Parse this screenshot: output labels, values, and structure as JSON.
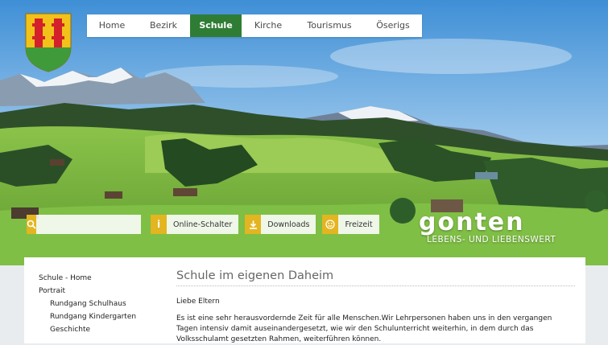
{
  "nav": {
    "items": [
      {
        "label": "Home",
        "active": false
      },
      {
        "label": "Bezirk",
        "active": false
      },
      {
        "label": "Schule",
        "active": true
      },
      {
        "label": "Kirche",
        "active": false
      },
      {
        "label": "Tourismus",
        "active": false
      },
      {
        "label": "Öserigs",
        "active": false
      }
    ]
  },
  "toolbar": {
    "search_placeholder": "",
    "buttons": [
      {
        "label": "Online-Schalter",
        "icon": "info-icon"
      },
      {
        "label": "Downloads",
        "icon": "download-icon"
      },
      {
        "label": "Freizeit",
        "icon": "smiley-icon"
      }
    ]
  },
  "brand": {
    "name": "gonten",
    "tagline": "LEBENS- UND LIEBENSWERT"
  },
  "sidebar": {
    "items": [
      {
        "label": "Schule - Home",
        "sub": false
      },
      {
        "label": "Portrait",
        "sub": false
      },
      {
        "label": "Rundgang Schulhaus",
        "sub": true
      },
      {
        "label": "Rundgang Kindergarten",
        "sub": true
      },
      {
        "label": "Geschichte",
        "sub": true
      }
    ]
  },
  "main": {
    "title": "Schule im eigenen Daheim",
    "greeting": "Liebe Eltern",
    "paragraph": "Es ist eine sehr herausvordernde Zeit für alle Menschen.Wir Lehrpersonen haben uns in den vergangen Tagen intensiv damit auseinandergesetzt, wie wir den Schulunterricht weiterhin, in dem durch das Volksschulamt gesetzten Rahmen, weiterführen können."
  },
  "colors": {
    "accent_green": "#2f7d34",
    "toolbar_yellow": "#e3b520",
    "crest_yellow": "#f2c21a",
    "crest_red": "#d4202a"
  }
}
